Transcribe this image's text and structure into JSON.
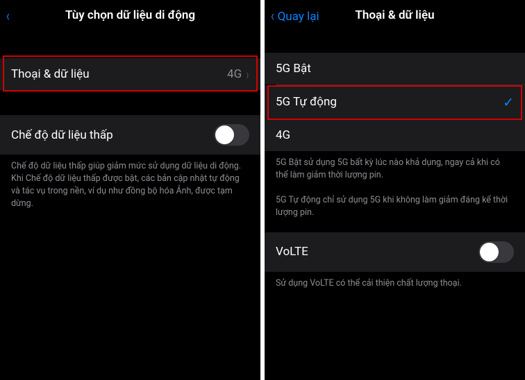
{
  "left": {
    "nav_title": "Tùy chọn dữ liệu di động",
    "voice_data": {
      "label": "Thoại & dữ liệu",
      "value": "4G"
    },
    "low_data": {
      "label": "Chế độ dữ liệu thấp",
      "on": false
    },
    "low_data_footer": "Chế độ dữ liệu thấp giúp giảm mức sử dụng dữ liệu di động. Khi Chế độ dữ liệu thấp được bật, các bản cập nhật tự động và tác vụ trong nền, ví dụ như đồng bộ hóa Ảnh, được tạm dừng."
  },
  "right": {
    "nav_back": "Quay lại",
    "nav_title": "Thoại & dữ liệu",
    "options": {
      "opt0": "5G Bật",
      "opt1": "5G Tự động",
      "opt2": "4G"
    },
    "footer1": "5G Bật sử dụng 5G bất kỳ lúc nào khả dụng, ngay cả khi có thể làm giảm thời lượng pin.",
    "footer2": "5G Tự động chỉ sử dụng 5G khi không làm giảm đáng kể thời lượng pin.",
    "volte": {
      "label": "VoLTE",
      "on": false
    },
    "volte_footer": "Sử dụng VoLTE có thể cải thiện chất lượng thoại."
  }
}
